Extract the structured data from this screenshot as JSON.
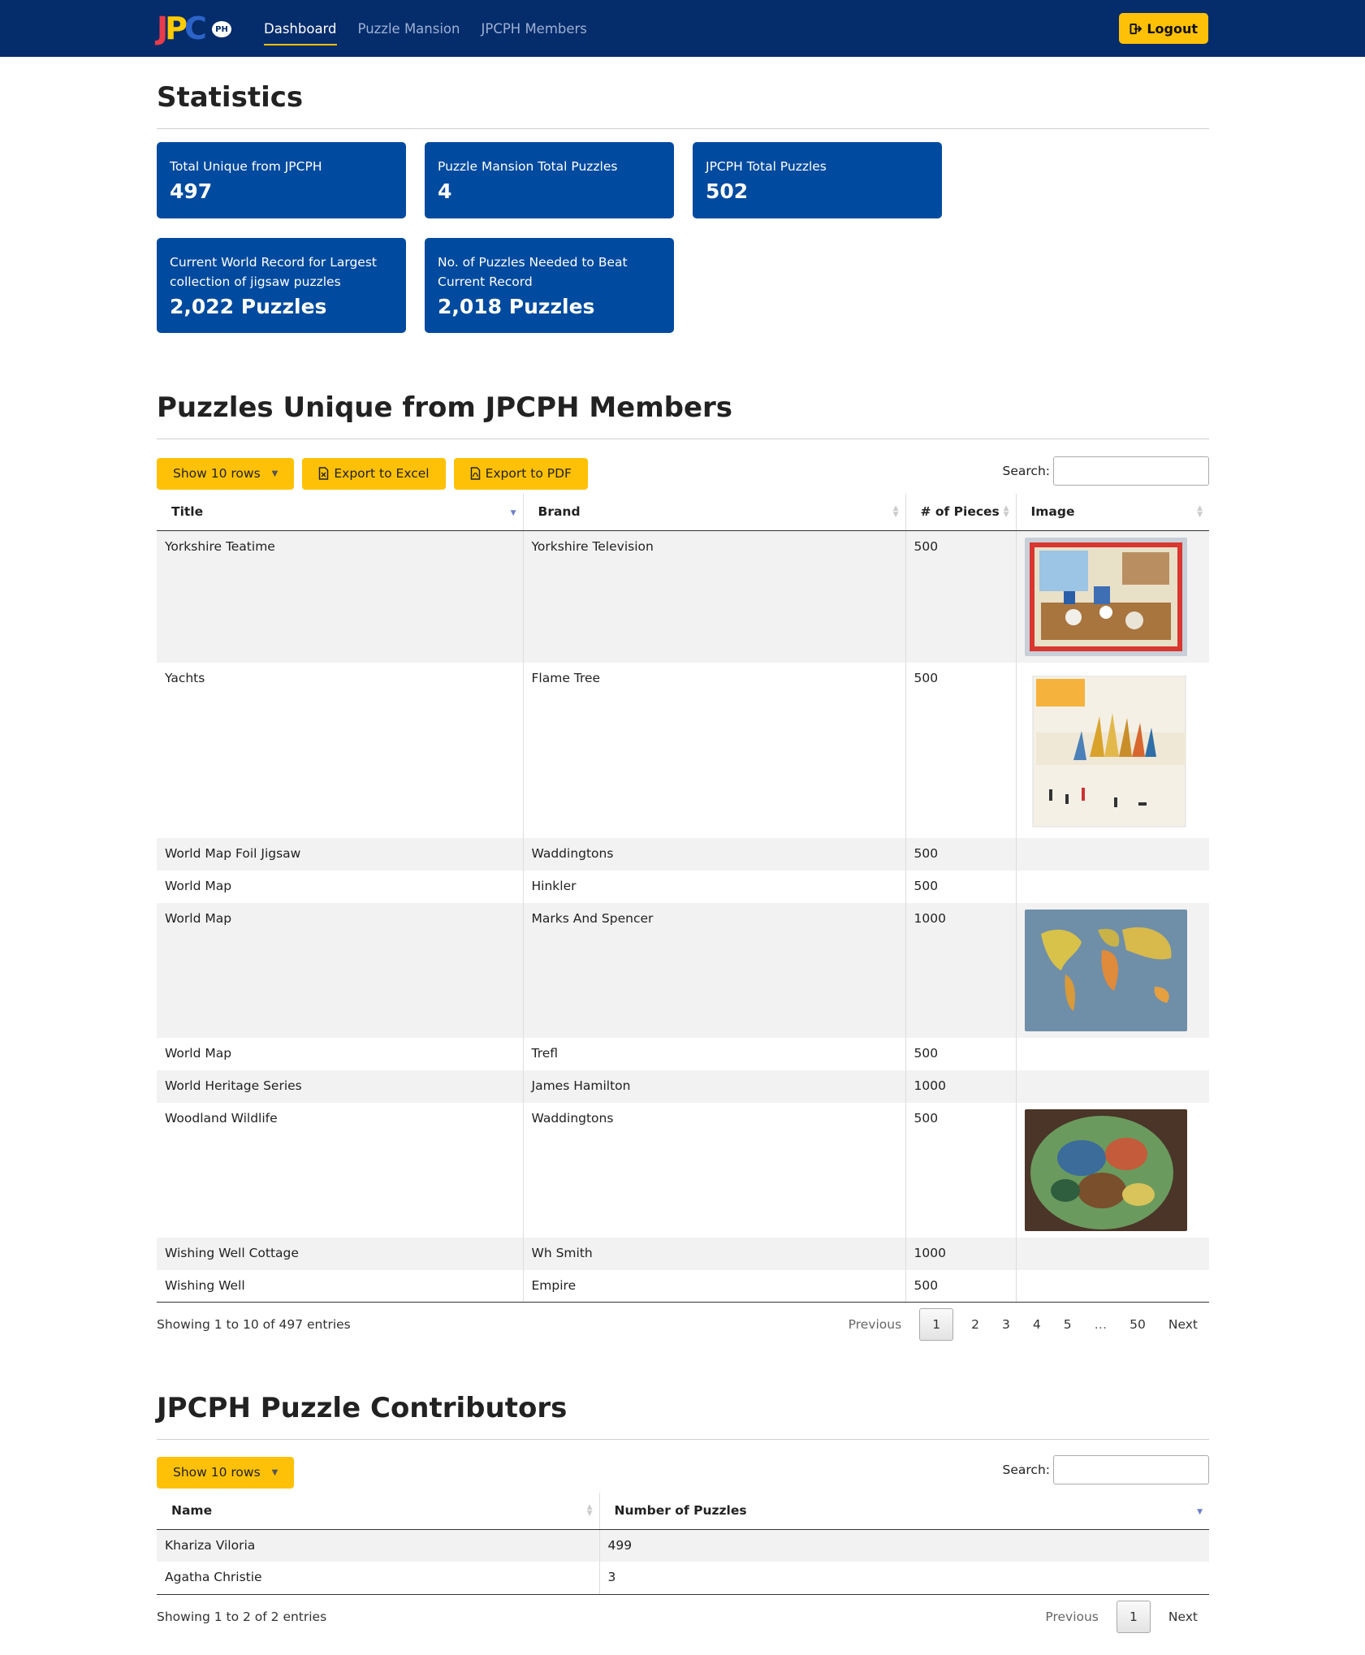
{
  "nav": {
    "brand": "JPCPH",
    "links": [
      {
        "label": "Dashboard",
        "active": true
      },
      {
        "label": "Puzzle Mansion",
        "active": false
      },
      {
        "label": "JPCPH Members",
        "active": false
      }
    ],
    "logout_label": "Logout"
  },
  "stats": {
    "title": "Statistics",
    "cards": [
      {
        "label": "Total Unique from JPCPH",
        "value": "497"
      },
      {
        "label": "Puzzle Mansion Total Puzzles",
        "value": "4"
      },
      {
        "label": "JPCPH Total Puzzles",
        "value": "502"
      },
      {
        "label": "Current World Record for Largest collection of jigsaw puzzles",
        "value": "2,022 Puzzles"
      },
      {
        "label": "No. of Puzzles Needed to Beat Current Record",
        "value": "2,018 Puzzles"
      }
    ]
  },
  "unique": {
    "title": "Puzzles Unique from JPCPH Members",
    "show_rows": "Show 10 rows",
    "export_excel": "Export to Excel",
    "export_pdf": "Export to PDF",
    "search_label": "Search:",
    "columns": [
      "Title",
      "Brand",
      "# of Pieces",
      "Image"
    ],
    "rows": [
      {
        "title": "Yorkshire Teatime",
        "brand": "Yorkshire Television",
        "pieces": "500",
        "image": "kitchen-puzzle"
      },
      {
        "title": "Yachts",
        "brand": "Flame Tree",
        "pieces": "500",
        "image": "yachts-puzzle"
      },
      {
        "title": "World Map Foil Jigsaw",
        "brand": "Waddingtons",
        "pieces": "500",
        "image": ""
      },
      {
        "title": "World Map",
        "brand": "Hinkler",
        "pieces": "500",
        "image": ""
      },
      {
        "title": "World Map",
        "brand": "Marks And Spencer",
        "pieces": "1000",
        "image": "world-map-puzzle"
      },
      {
        "title": "World Map",
        "brand": "Trefl",
        "pieces": "500",
        "image": ""
      },
      {
        "title": "World Heritage Series",
        "brand": "James Hamilton",
        "pieces": "1000",
        "image": ""
      },
      {
        "title": "Woodland Wildlife",
        "brand": "Waddingtons",
        "pieces": "500",
        "image": "woodland-puzzle"
      },
      {
        "title": "Wishing Well Cottage",
        "brand": "Wh Smith",
        "pieces": "1000",
        "image": ""
      },
      {
        "title": "Wishing Well",
        "brand": "Empire",
        "pieces": "500",
        "image": ""
      }
    ],
    "info": "Showing 1 to 10 of 497 entries",
    "pager": {
      "previous": "Previous",
      "pages": [
        "1",
        "2",
        "3",
        "4",
        "5",
        "…",
        "50"
      ],
      "next": "Next"
    }
  },
  "contributors": {
    "title": "JPCPH Puzzle Contributors",
    "show_rows": "Show 10 rows",
    "search_label": "Search:",
    "columns": [
      "Name",
      "Number of Puzzles"
    ],
    "rows": [
      {
        "name": "Khariza Viloria",
        "count": "499"
      },
      {
        "name": "Agatha Christie",
        "count": "3"
      }
    ],
    "info": "Showing 1 to 2 of 2 entries",
    "pager": {
      "previous": "Previous",
      "pages": [
        "1"
      ],
      "next": "Next"
    }
  }
}
